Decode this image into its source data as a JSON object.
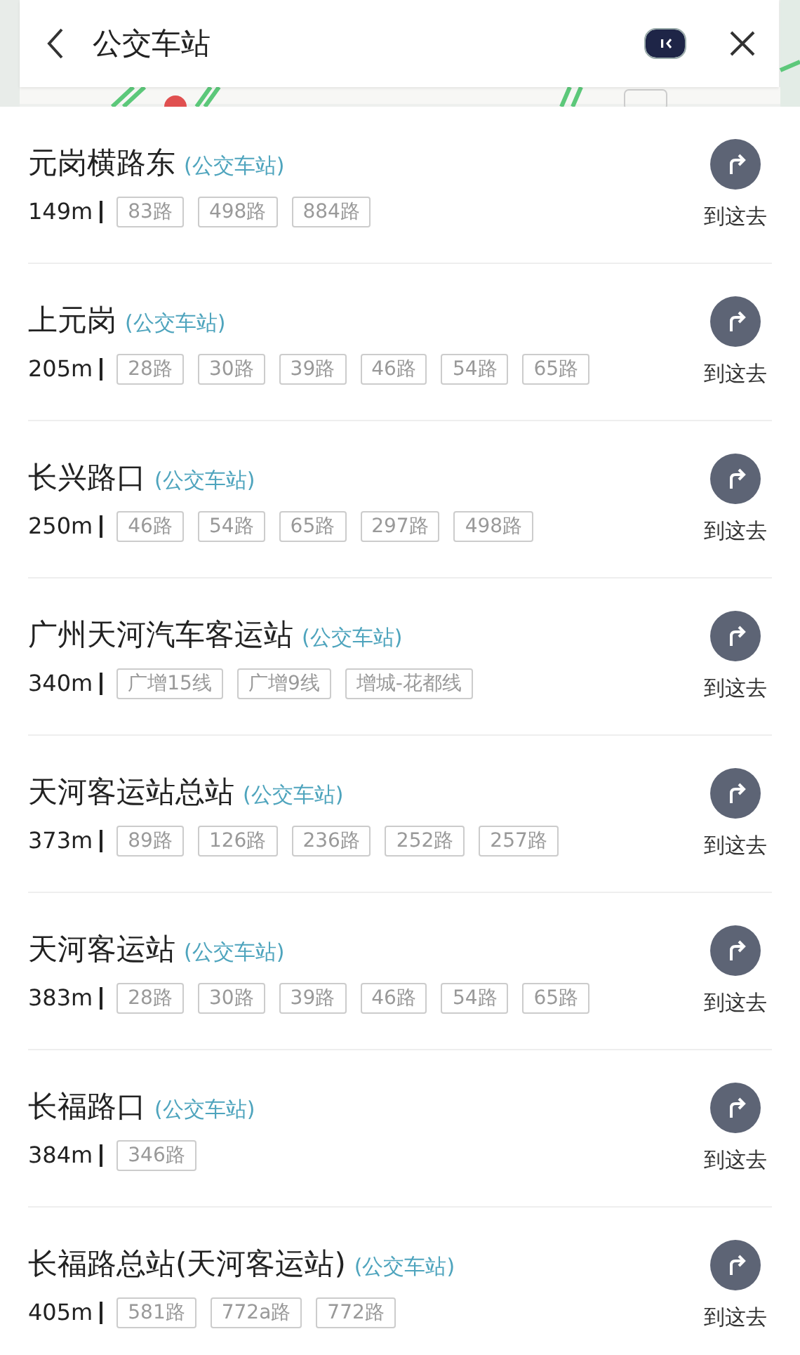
{
  "search": {
    "value": "公交车站"
  },
  "results": [
    {
      "name": "元岗横路东",
      "type": "(公交车站)",
      "distance": "149m",
      "routes": [
        "83路",
        "498路",
        "884路"
      ],
      "action": "到这去"
    },
    {
      "name": "上元岗",
      "type": "(公交车站)",
      "distance": "205m",
      "routes": [
        "28路",
        "30路",
        "39路",
        "46路",
        "54路",
        "65路"
      ],
      "action": "到这去"
    },
    {
      "name": "长兴路口",
      "type": "(公交车站)",
      "distance": "250m",
      "routes": [
        "46路",
        "54路",
        "65路",
        "297路",
        "498路"
      ],
      "action": "到这去"
    },
    {
      "name": "广州天河汽车客运站",
      "type": "(公交车站)",
      "distance": "340m",
      "routes": [
        "广增15线",
        "广增9线",
        "增城-花都线"
      ],
      "action": "到这去"
    },
    {
      "name": "天河客运站总站",
      "type": "(公交车站)",
      "distance": "373m",
      "routes": [
        "89路",
        "126路",
        "236路",
        "252路",
        "257路"
      ],
      "action": "到这去"
    },
    {
      "name": "天河客运站",
      "type": "(公交车站)",
      "distance": "383m",
      "routes": [
        "28路",
        "30路",
        "39路",
        "46路",
        "54路",
        "65路"
      ],
      "action": "到这去"
    },
    {
      "name": "长福路口",
      "type": "(公交车站)",
      "distance": "384m",
      "routes": [
        "346路"
      ],
      "action": "到这去"
    },
    {
      "name": "长福路总站(天河客运站)",
      "type": "(公交车站)",
      "distance": "405m",
      "routes": [
        "581路",
        "772a路",
        "772路"
      ],
      "action": "到这去"
    }
  ]
}
